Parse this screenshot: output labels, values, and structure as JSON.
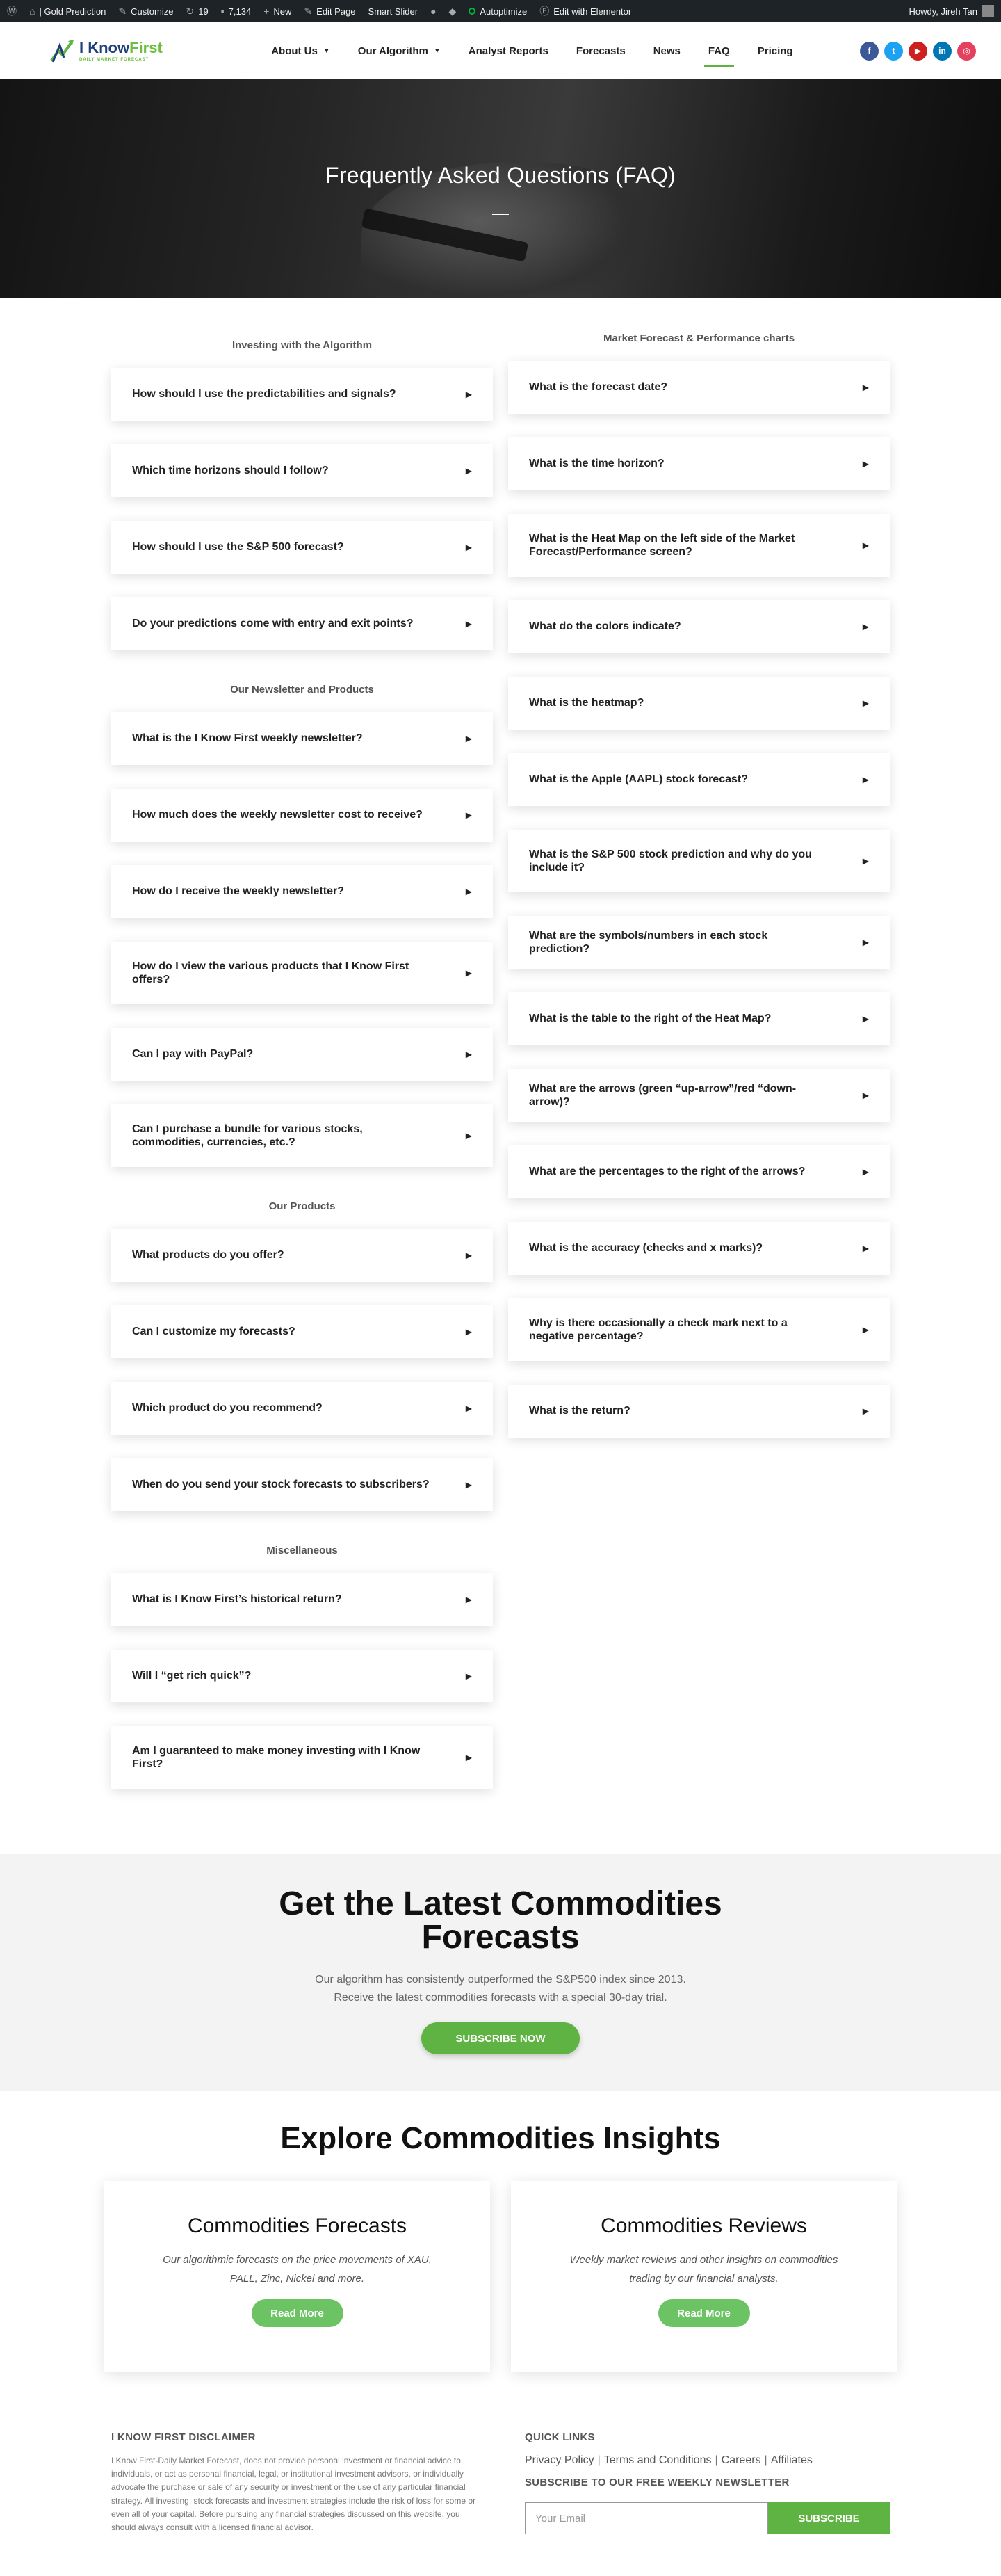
{
  "adminbar": {
    "site": "| Gold Prediction",
    "customize": "Customize",
    "updates": "19",
    "comments": "7,134",
    "new": "New",
    "edit_page": "Edit Page",
    "smart_slider": "Smart Slider",
    "autoptimize": "Autoptimize",
    "elementor": "Edit with Elementor",
    "howdy": "Howdy, Jireh Tan"
  },
  "logo": {
    "i": "I ",
    "know": "Know",
    "first": "First",
    "sub": "DAILY MARKET FORECAST"
  },
  "nav": [
    {
      "label": "About Us",
      "dropdown": true
    },
    {
      "label": "Our Algorithm",
      "dropdown": true
    },
    {
      "label": "Analyst Reports",
      "dropdown": false
    },
    {
      "label": "Forecasts",
      "dropdown": false
    },
    {
      "label": "News",
      "dropdown": false
    },
    {
      "label": "FAQ",
      "dropdown": false,
      "active": true
    },
    {
      "label": "Pricing",
      "dropdown": false
    }
  ],
  "socials": [
    {
      "icon": "facebook-icon",
      "glyph": "f",
      "color": "#3b5998"
    },
    {
      "icon": "twitter-icon",
      "glyph": "t",
      "color": "#1da1f2"
    },
    {
      "icon": "youtube-icon",
      "glyph": "▶",
      "color": "#cd201f"
    },
    {
      "icon": "linkedin-icon",
      "glyph": "in",
      "color": "#0077b5"
    },
    {
      "icon": "instagram-icon",
      "glyph": "◎",
      "color": "#e4405f"
    }
  ],
  "hero": {
    "title": "Frequently Asked Questions (FAQ)"
  },
  "faq_left": [
    {
      "category": "Investing with the Algorithm",
      "questions": [
        "How should I use the predictabilities and signals?",
        "Which time horizons should I follow?",
        "How should I use the S&P 500 forecast?",
        "Do your predictions come with entry and exit points?"
      ]
    },
    {
      "category": "Our Newsletter and Products",
      "questions": [
        "What is the I Know First weekly newsletter?",
        "How much does the weekly newsletter cost to receive?",
        "How do I receive the weekly newsletter?",
        "How do I view the various products that I Know First offers?",
        "Can I pay with PayPal?",
        "Can I purchase a bundle for various stocks, commodities, currencies, etc.?"
      ]
    },
    {
      "category": "Our Products",
      "questions": [
        "What products do you offer?",
        "Can I customize my forecasts?",
        "Which product do you recommend?",
        "When do you send your stock forecasts to subscribers?"
      ]
    },
    {
      "category": "Miscellaneous",
      "questions": [
        "What is I Know First’s historical return?",
        "Will I “get rich quick”?",
        "Am I guaranteed to make money investing with I Know First?"
      ]
    }
  ],
  "faq_right": {
    "category": "Market Forecast & Performance charts",
    "questions": [
      "What is the forecast date?",
      "What is the time horizon?",
      "What is the Heat Map on the left side of the Market Forecast/Performance screen?",
      "What do the colors indicate?",
      "What is the heatmap?",
      "What is the Apple (AAPL) stock forecast?",
      "What is the S&P 500 stock prediction and why do you include it?",
      "What are the symbols/numbers in each stock prediction?",
      "What is the table to the right of the Heat Map?",
      "What are the arrows (green “up-arrow”/red “down-arrow)?",
      "What are the percentages to the right of the arrows?",
      "What is the accuracy (checks and x marks)?",
      "Why is there occasionally a check mark next to a negative percentage?",
      "What is the return?"
    ]
  },
  "cta": {
    "title": "Get the Latest Commodities Forecasts",
    "line1": "Our algorithm has consistently outperformed the S&P500 index since 2013.",
    "line2": "Receive the latest commodities forecasts with a special 30-day trial.",
    "button": "SUBSCRIBE NOW"
  },
  "explore": {
    "title": "Explore Commodities Insights",
    "cards": [
      {
        "title": "Commodities Forecasts",
        "text": "Our algorithmic forecasts on the price movements of XAU, PALL, Zinc, Nickel and more.",
        "button": "Read More"
      },
      {
        "title": "Commodities Reviews",
        "text": "Weekly market reviews and other insights on commodities trading by our financial analysts.",
        "button": "Read More"
      }
    ]
  },
  "footer": {
    "disclaimer_title": "I KNOW FIRST DISCLAIMER",
    "disclaimer_text": "I Know First-Daily Market Forecast, does not provide personal investment or financial advice to individuals, or act as personal financial, legal, or institutional investment advisors, or individually advocate the purchase or sale of any security or investment or the use of any particular financial strategy. All investing, stock forecasts and investment strategies include the risk of loss for some or even all of your capital. Before pursuing any financial strategies discussed on this website, you should always consult with a licensed financial advisor.",
    "quick_title": "QUICK LINKS",
    "links": [
      "Privacy Policy",
      "Terms and Conditions",
      "Careers",
      "Affiliates"
    ],
    "subscribe_title": "SUBSCRIBE TO OUR FREE WEEKLY NEWSLETTER",
    "email_placeholder": "Your Email",
    "subscribe_button": "SUBSCRIBE"
  }
}
